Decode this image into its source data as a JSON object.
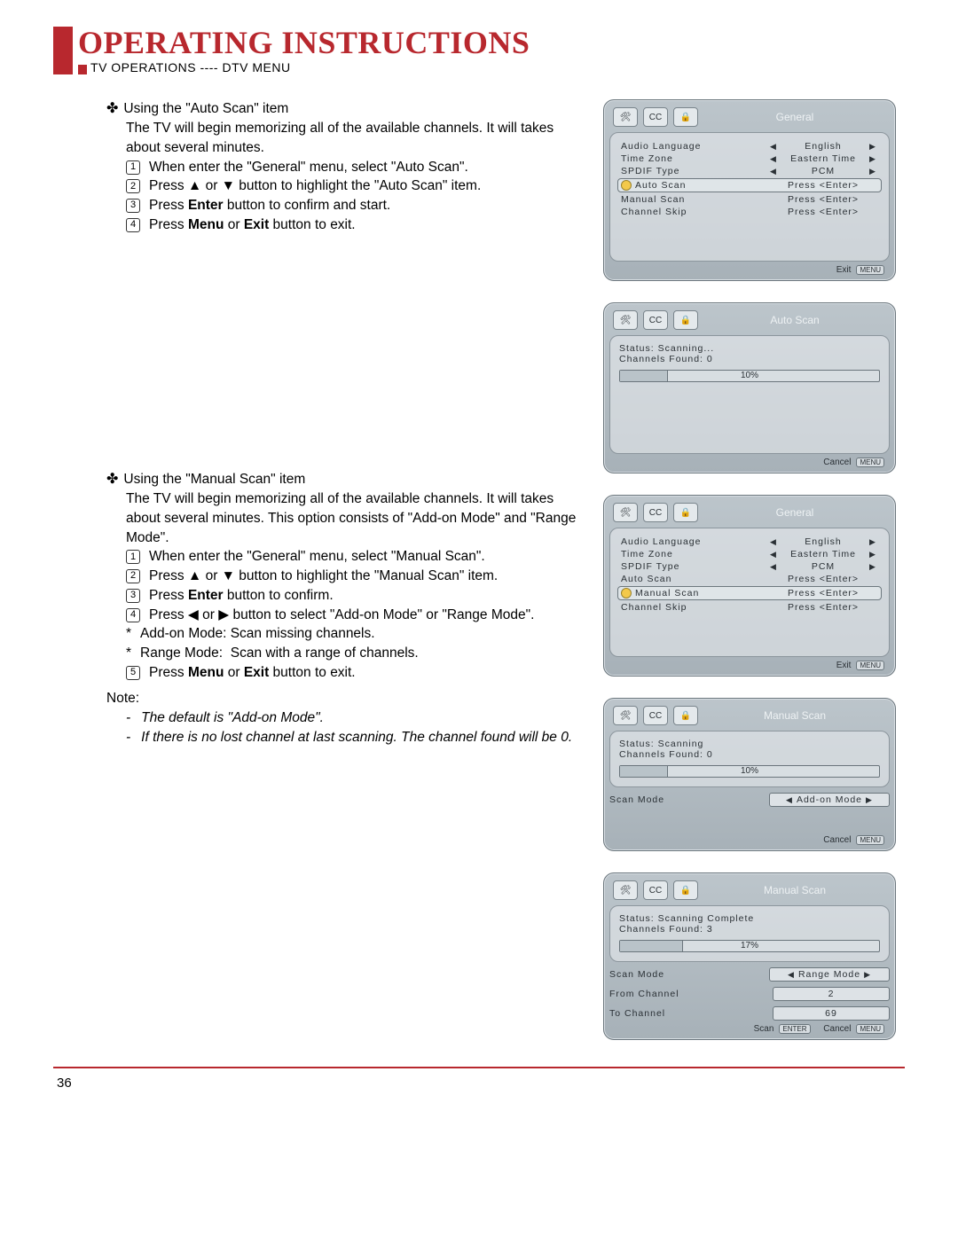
{
  "header": {
    "title": "OPERATING INSTRUCTIONS",
    "subtitle": "TV OPERATIONS ---- DTV MENU"
  },
  "page_number": "36",
  "section1": {
    "heading": "Using the \"Auto Scan\" item",
    "intro": "The TV will begin memorizing all of the available channels. It will takes about several minutes.",
    "steps": [
      "When enter the \"General\" menu, select \"Auto Scan\".",
      "Press ▲ or ▼ button to highlight the \"Auto Scan\" item.",
      "Press Enter button to confirm and start.",
      "Press Menu or Exit button to exit."
    ],
    "step3_prefix": "Press ",
    "step3_bold": "Enter",
    "step3_suffix": " button to confirm and start.",
    "step4_prefix": "Press ",
    "step4_bold": "Menu",
    "step4_mid": " or ",
    "step4_bold2": "Exit",
    "step4_suffix": " button to exit."
  },
  "section2": {
    "heading": "Using the \"Manual Scan\" item",
    "intro": "The TV will begin memorizing all of the available channels. It will takes about several minutes. This option consists of \"Add-on Mode\" and \"Range Mode\".",
    "s1": "When enter the \"General\" menu, select \"Manual Scan\".",
    "s2": "Press ▲ or ▼ button to highlight the \"Manual Scan\" item.",
    "s3_prefix": "Press ",
    "s3_bold": "Enter",
    "s3_suffix": " button to confirm.",
    "s4": "Press ◀ or ▶ button to select \"Add-on Mode\" or \"Range Mode\".",
    "star1": "Add-on Mode: Scan missing channels.",
    "star2a": "Range Mode:",
    "star2b": "Scan with a range of channels.",
    "s5_prefix": "Press ",
    "s5_bold": "Menu",
    "s5_mid": " or ",
    "s5_bold2": "Exit",
    "s5_suffix": " button to exit.",
    "note_label": "Note:",
    "note1": "The default is \"Add-on Mode\".",
    "note2": "If there is no lost channel at last scanning. The channel found will be 0."
  },
  "osd_general": {
    "title": "General",
    "rows": {
      "audio_lang_l": "Audio Language",
      "audio_lang_v": "English",
      "tz_l": "Time Zone",
      "tz_v": "Eastern Time",
      "spdif_l": "SPDIF Type",
      "spdif_v": "PCM",
      "auto_l": "Auto Scan",
      "auto_v": "Press <Enter>",
      "manual_l": "Manual Scan",
      "manual_v": "Press <Enter>",
      "skip_l": "Channel Skip",
      "skip_v": "Press <Enter>"
    },
    "exit": "Exit",
    "menu_btn": "MENU"
  },
  "osd_autoscan": {
    "title": "Auto Scan",
    "status": "Status: Scanning...",
    "found": "Channels Found: 0",
    "pct": "10%",
    "cancel": "Cancel"
  },
  "osd_manual_addon": {
    "title": "Manual Scan",
    "status": "Status: Scanning",
    "found": "Channels Found: 0",
    "pct": "10%",
    "mode_l": "Scan Mode",
    "mode_v": "Add-on Mode",
    "cancel": "Cancel"
  },
  "osd_manual_range": {
    "title": "Manual Scan",
    "status": "Status: Scanning Complete",
    "found": "Channels Found: 3",
    "pct": "17%",
    "mode_l": "Scan Mode",
    "mode_v": "Range Mode",
    "from_l": "From Channel",
    "from_v": "2",
    "to_l": "To Channel",
    "to_v": "69",
    "scan": "Scan",
    "enter_btn": "ENTER",
    "cancel": "Cancel"
  },
  "icons": {
    "tool": "🛠",
    "cc": "CC",
    "lock": "🔒"
  }
}
